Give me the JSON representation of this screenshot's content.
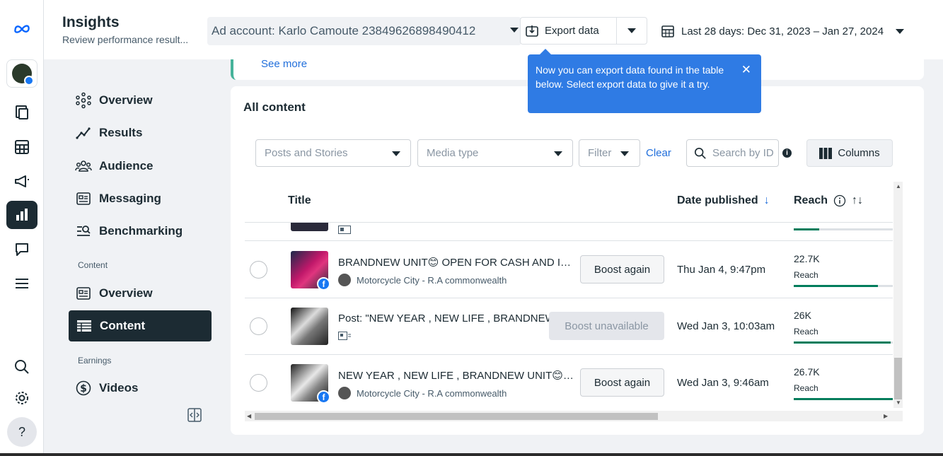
{
  "header": {
    "title": "Insights",
    "subtitle": "Review performance result...",
    "ad_account": "Ad account: Karlo Camoute 23849626898490412",
    "export_label": "Export data",
    "date_range": "Last 28 days: Dec 31, 2023 – Jan 27, 2024"
  },
  "nav": {
    "items": [
      {
        "label": "Overview",
        "icon": "network-icon"
      },
      {
        "label": "Results",
        "icon": "trend-icon"
      },
      {
        "label": "Audience",
        "icon": "people-icon"
      },
      {
        "label": "Messaging",
        "icon": "message-icon"
      },
      {
        "label": "Benchmarking",
        "icon": "benchmark-icon"
      }
    ],
    "content_section": "Content",
    "content_items": [
      {
        "label": "Overview",
        "icon": "overview-icon"
      },
      {
        "label": "Content",
        "icon": "table-icon",
        "selected": true
      }
    ],
    "earnings_section": "Earnings",
    "earnings_items": [
      {
        "label": "Videos",
        "icon": "dollar-icon"
      }
    ]
  },
  "top_card": {
    "see_more": "See more"
  },
  "content": {
    "title": "All content",
    "filters": {
      "posts_and_stories": "Posts and Stories",
      "media_type": "Media type",
      "filter": "Filter",
      "clear": "Clear",
      "search_placeholder": "Search by ID",
      "columns": "Columns"
    },
    "columns": {
      "title": "Title",
      "date_published": "Date published",
      "reach": "Reach"
    },
    "rows": [
      {
        "title": "BRANDNEW UNIT😊 OPEN FOR CASH AND INSTALLMENT",
        "page": "Motorcycle City - R.A commonwealth",
        "action": "Boost again",
        "date": "Thu Jan 4, 9:47pm",
        "reach": "22.7K",
        "reach_label": "Reach",
        "reach_fraction": 0.85
      },
      {
        "title": "Post: \"NEW YEAR , NEW LIFE , BRANDNEW UNIT\"",
        "page": "",
        "action": "Boost unavailable",
        "date": "Wed Jan 3, 10:03am",
        "reach": "26K",
        "reach_label": "Reach",
        "reach_fraction": 0.98
      },
      {
        "title": "NEW YEAR , NEW LIFE , BRANDNEW UNIT😊 OPEN FOR CASH",
        "page": "Motorcycle City - R.A commonwealth",
        "action": "Boost again",
        "date": "Wed Jan 3, 9:46am",
        "reach": "26.7K",
        "reach_label": "Reach",
        "reach_fraction": 1.0
      }
    ]
  },
  "tooltip": {
    "text": "Now you can export data found in the table below. Select export data to give it a try.",
    "close": "✕"
  },
  "rail": {
    "help": "?"
  },
  "colors": {
    "accent": "#216fdb",
    "dark": "#1c2b33",
    "reach_bar": "#007d5c",
    "tooltip": "#2f7be4"
  }
}
